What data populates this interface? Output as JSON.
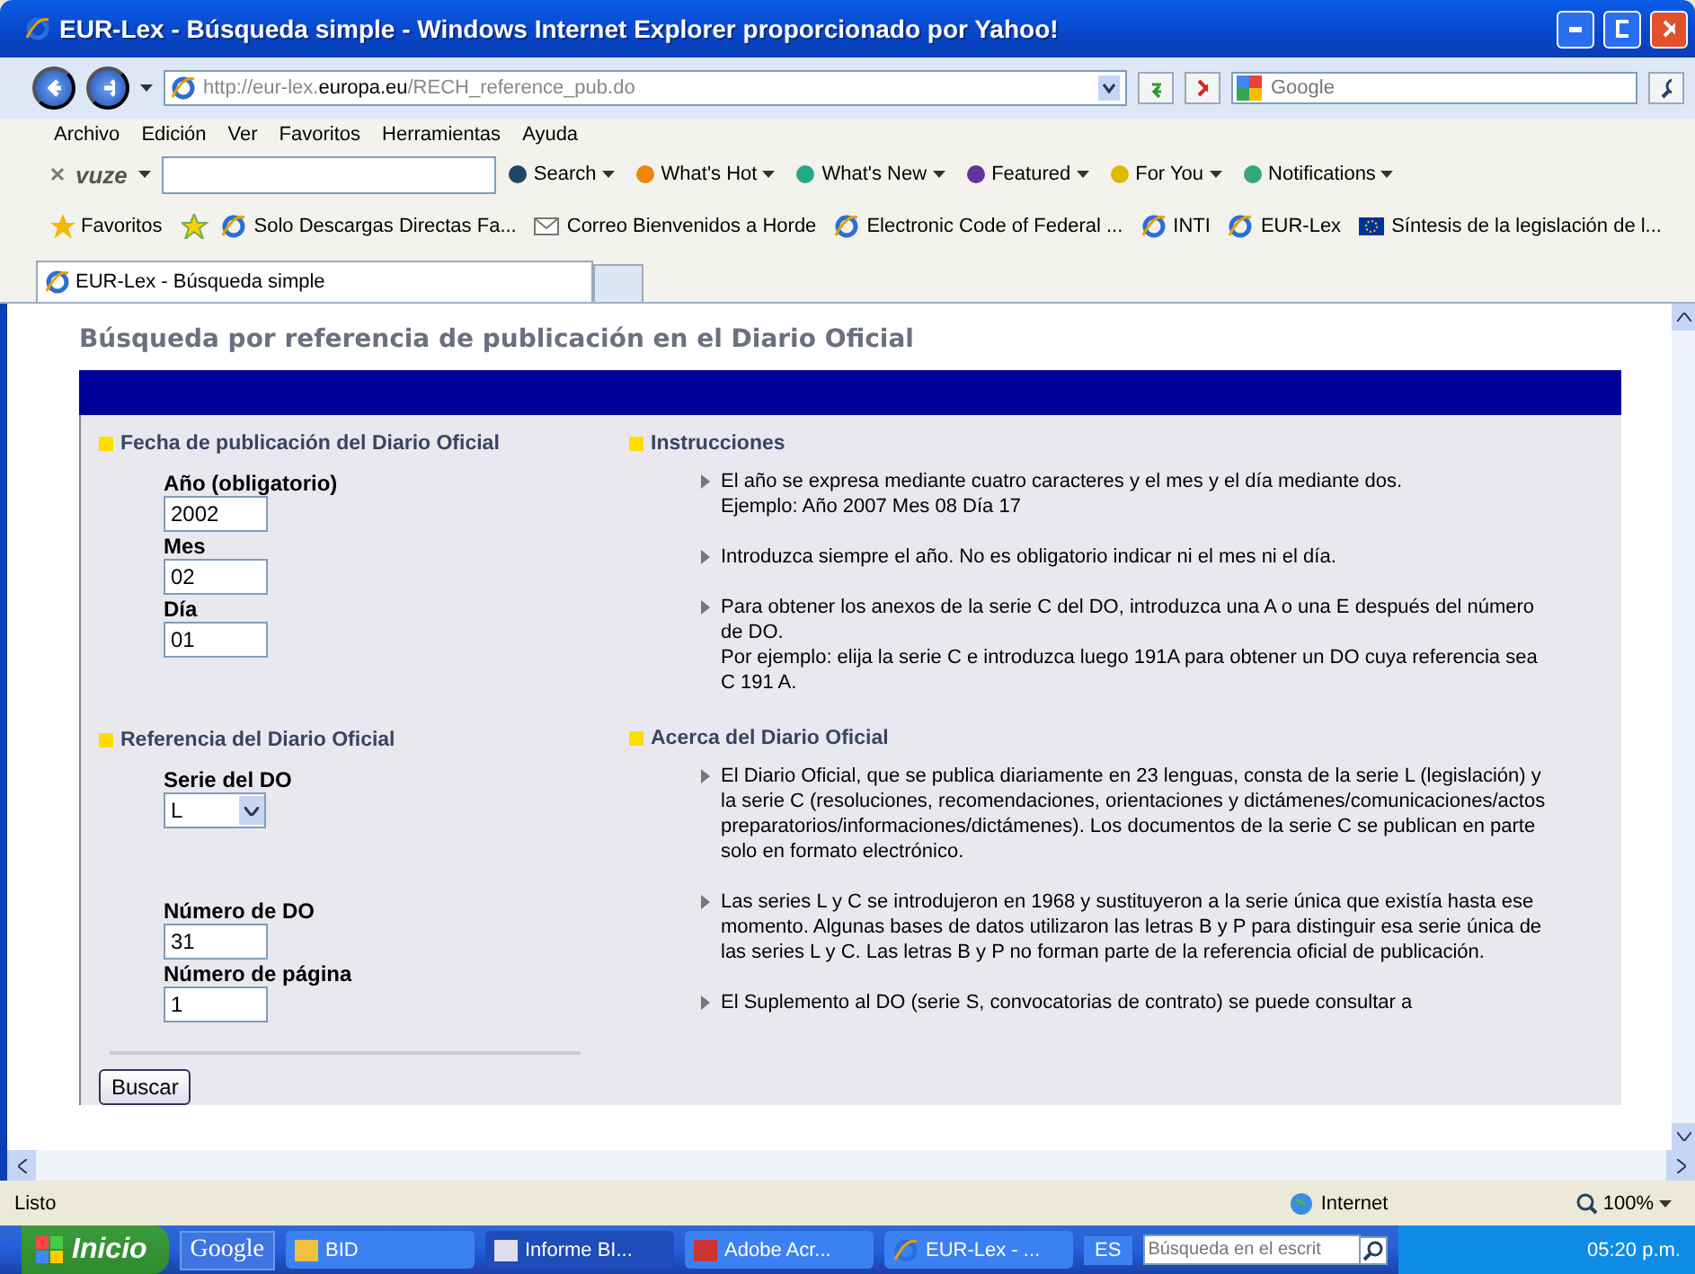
{
  "window": {
    "title": "EUR-Lex - Búsqueda simple - Windows Internet Explorer proporcionado por Yahoo!"
  },
  "address_bar": {
    "url_scheme": "http://eur-lex.",
    "url_domain": "europa.eu",
    "url_path": "/RECH_reference_pub.do",
    "search_placeholder": "Google"
  },
  "menu": [
    "Archivo",
    "Edición",
    "Ver",
    "Favoritos",
    "Herramientas",
    "Ayuda"
  ],
  "toolbar": {
    "brand": "vuze",
    "items": [
      "Search",
      "What's Hot",
      "What's New",
      "Featured",
      "For You",
      "Notifications"
    ]
  },
  "favorites": {
    "label": "Favoritos",
    "links": [
      "Solo Descargas Directas Fa...",
      "Correo  Bienvenidos a Horde",
      "Electronic Code of Federal ...",
      "INTI",
      "EUR-Lex",
      "Síntesis de la legislación de l..."
    ]
  },
  "tabs": [
    {
      "label": "EUR-Lex - Búsqueda simple",
      "selected": true
    }
  ],
  "page": {
    "heading": "Búsqueda por referencia de publicación en el Diario Oficial",
    "left_sections": [
      {
        "title": "Fecha de publicación del Diario Oficial",
        "fields": [
          {
            "kind": "text",
            "label": "Año (obligatorio)",
            "value": "2002"
          },
          {
            "kind": "text",
            "label": "Mes",
            "value": "02"
          },
          {
            "kind": "text",
            "label": "Día",
            "value": "01"
          }
        ]
      },
      {
        "title": "Referencia del Diario Oficial",
        "fields": [
          {
            "kind": "select",
            "label": "Serie del DO",
            "value": "L"
          },
          {
            "kind": "text",
            "label": "Número de DO",
            "value": "31"
          },
          {
            "kind": "text",
            "label": "Número de página",
            "value": "1"
          }
        ]
      }
    ],
    "button": "Buscar",
    "right_sections": [
      {
        "title": "Instrucciones",
        "items": [
          [
            "El año se expresa mediante cuatro caracteres y el mes y el día mediante dos.",
            "Ejemplo: Año 2007 Mes 08 Día 17"
          ],
          [
            "Introduzca siempre el año. No es obligatorio indicar ni el mes ni el día."
          ],
          [
            "Para obtener los anexos de la serie C del DO, introduzca una A o una E después del número de DO.",
            "Por ejemplo: elija la serie C e introduzca luego 191A para obtener un DO cuya referencia sea C 191 A."
          ]
        ]
      },
      {
        "title": "Acerca del Diario Oficial",
        "items": [
          [
            "El Diario Oficial, que se publica diariamente en 23 lenguas, consta de la serie L (legislación) y la serie C (resoluciones, recomendaciones, orientaciones y dictámenes/comunicaciones/actos preparatorios/informaciones/dictámenes). Los documentos de la serie C se publican en parte solo en formato electrónico."
          ],
          [
            "Las series L y C se introdujeron en 1968 y sustituyeron a la serie única que existía hasta ese momento. Algunas bases de datos utilizaron las letras B y P para distinguir esa serie única de las series L y C. Las letras B y P no forman parte de la referencia oficial de publicación."
          ],
          [
            "El Suplemento al DO (serie S, convocatorias de contrato) se puede consultar a"
          ]
        ]
      }
    ]
  },
  "status_bar": {
    "text": "Listo",
    "zone": "Internet",
    "zoom": "100%"
  },
  "taskbar": {
    "start": "Inicio",
    "google": "Google",
    "items": [
      {
        "label": "BID",
        "selected": false
      },
      {
        "label": "Informe BI...",
        "selected": true
      },
      {
        "label": "Adobe Acr...",
        "selected": false
      },
      {
        "label": "EUR-Lex - ...",
        "selected": false
      }
    ],
    "language": "ES",
    "search_placeholder": "Búsqueda en el escrit",
    "clock": "05:20 p.m."
  }
}
